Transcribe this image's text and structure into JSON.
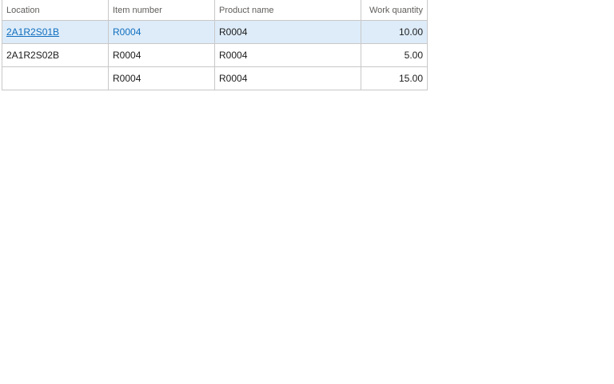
{
  "grid": {
    "columns": {
      "location": "Location",
      "item_number": "Item number",
      "product_name": "Product name",
      "work_quantity": "Work quantity"
    },
    "rows": [
      {
        "location": "2A1R2S01B",
        "item_number": "R0004",
        "product_name": "R0004",
        "work_quantity": "10.00"
      },
      {
        "location": "2A1R2S02B",
        "item_number": "R0004",
        "product_name": "R0004",
        "work_quantity": "5.00"
      },
      {
        "location": "",
        "item_number": "R0004",
        "product_name": "R0004",
        "work_quantity": "15.00"
      }
    ]
  },
  "colors": {
    "selected_row_bg": "#deecf9",
    "link": "#106ebe",
    "grid_line": "#c8c8c8"
  }
}
